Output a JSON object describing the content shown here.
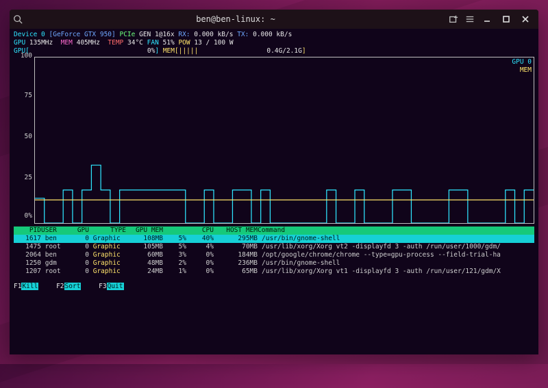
{
  "window": {
    "title": "ben@ben-linux: ~"
  },
  "device": {
    "label": "Device 0",
    "name": "[GeForce GTX 950]",
    "pcie_label": "PCIe",
    "gen_label": "GEN",
    "gen": "1@16x",
    "rx_label": "RX:",
    "rx": "0.000 kB/s",
    "tx_label": "TX:",
    "tx": "0.000 kB/s",
    "gpu_clk_label": "GPU",
    "gpu_clk": "135MHz",
    "mem_clk_label": "MEM",
    "mem_clk": "405MHz",
    "temp_label": "TEMP",
    "temp": "34°C",
    "fan_label": "FAN",
    "fan": "51%",
    "pow_label": "POW",
    "pow": "13 / 100 W",
    "gpu_bar_label": "GPU",
    "gpu_bar_pct": "0%",
    "mem_bar_label": "MEM",
    "mem_bar_pct": "0.4G/2.1G"
  },
  "chart_data": {
    "type": "line",
    "title": "",
    "xlabel": "",
    "ylabel": "",
    "ylim": [
      0,
      100
    ],
    "yticks": [
      0,
      25,
      50,
      75,
      100
    ],
    "legend": [
      "GPU 0",
      "MEM"
    ],
    "series": [
      {
        "name": "GPU 0",
        "color": "#2ee6ff",
        "values": [
          15,
          0,
          0,
          20,
          0,
          20,
          35,
          20,
          0,
          20,
          20,
          20,
          20,
          20,
          20,
          20,
          0,
          0,
          20,
          0,
          0,
          20,
          20,
          0,
          20,
          0,
          0,
          0,
          0,
          0,
          0,
          20,
          0,
          0,
          20,
          0,
          0,
          0,
          20,
          20,
          0,
          0,
          0,
          0,
          20,
          20,
          0,
          0,
          0,
          0,
          20,
          0,
          20,
          20
        ]
      },
      {
        "name": "MEM",
        "color": "#ffe46b",
        "values": [
          14,
          14,
          14,
          14,
          14,
          14,
          14,
          14,
          14,
          14,
          14,
          14,
          14,
          14,
          14,
          14,
          14,
          14,
          14,
          14,
          14,
          14,
          14,
          14,
          14,
          14,
          14,
          14,
          14,
          14,
          14,
          14,
          14,
          14,
          14,
          14,
          14,
          14,
          14,
          14,
          14,
          14,
          14,
          14,
          14,
          14,
          14,
          14,
          14,
          14,
          14,
          14,
          14,
          14
        ]
      }
    ]
  },
  "columns": {
    "pid": "PID",
    "user": "USER",
    "gpu": "GPU",
    "type": "TYPE",
    "gpum": "GPU MEM",
    "cpu": "CPU",
    "host": "HOST MEM",
    "cmd": "Command"
  },
  "processes": [
    {
      "pid": "1617",
      "user": "ben",
      "gpu": "0",
      "type": "Graphic",
      "gpum": "108MB",
      "mem": "5%",
      "cpu": "40%",
      "host": "295MB",
      "cmd": "/usr/bin/gnome-shell",
      "selected": true
    },
    {
      "pid": "1475",
      "user": "root",
      "gpu": "0",
      "type": "Graphic",
      "gpum": "105MB",
      "mem": "5%",
      "cpu": "4%",
      "host": "70MB",
      "cmd": "/usr/lib/xorg/Xorg vt2 -displayfd 3 -auth /run/user/1000/gdm/"
    },
    {
      "pid": "2064",
      "user": "ben",
      "gpu": "0",
      "type": "Graphic",
      "gpum": "60MB",
      "mem": "3%",
      "cpu": "0%",
      "host": "184MB",
      "cmd": "/opt/google/chrome/chrome --type=gpu-process --field-trial-ha"
    },
    {
      "pid": "1250",
      "user": "gdm",
      "gpu": "0",
      "type": "Graphic",
      "gpum": "48MB",
      "mem": "2%",
      "cpu": "0%",
      "host": "236MB",
      "cmd": "/usr/bin/gnome-shell"
    },
    {
      "pid": "1207",
      "user": "root",
      "gpu": "0",
      "type": "Graphic",
      "gpum": "24MB",
      "mem": "1%",
      "cpu": "0%",
      "host": "65MB",
      "cmd": "/usr/lib/xorg/Xorg vt1 -displayfd 3 -auth /run/user/121/gdm/X"
    }
  ],
  "footer": {
    "f1_key": "F1",
    "f1": "Kill",
    "f2_key": "F2",
    "f2": "Sort",
    "f3_key": "F3",
    "f3": "Quit"
  }
}
